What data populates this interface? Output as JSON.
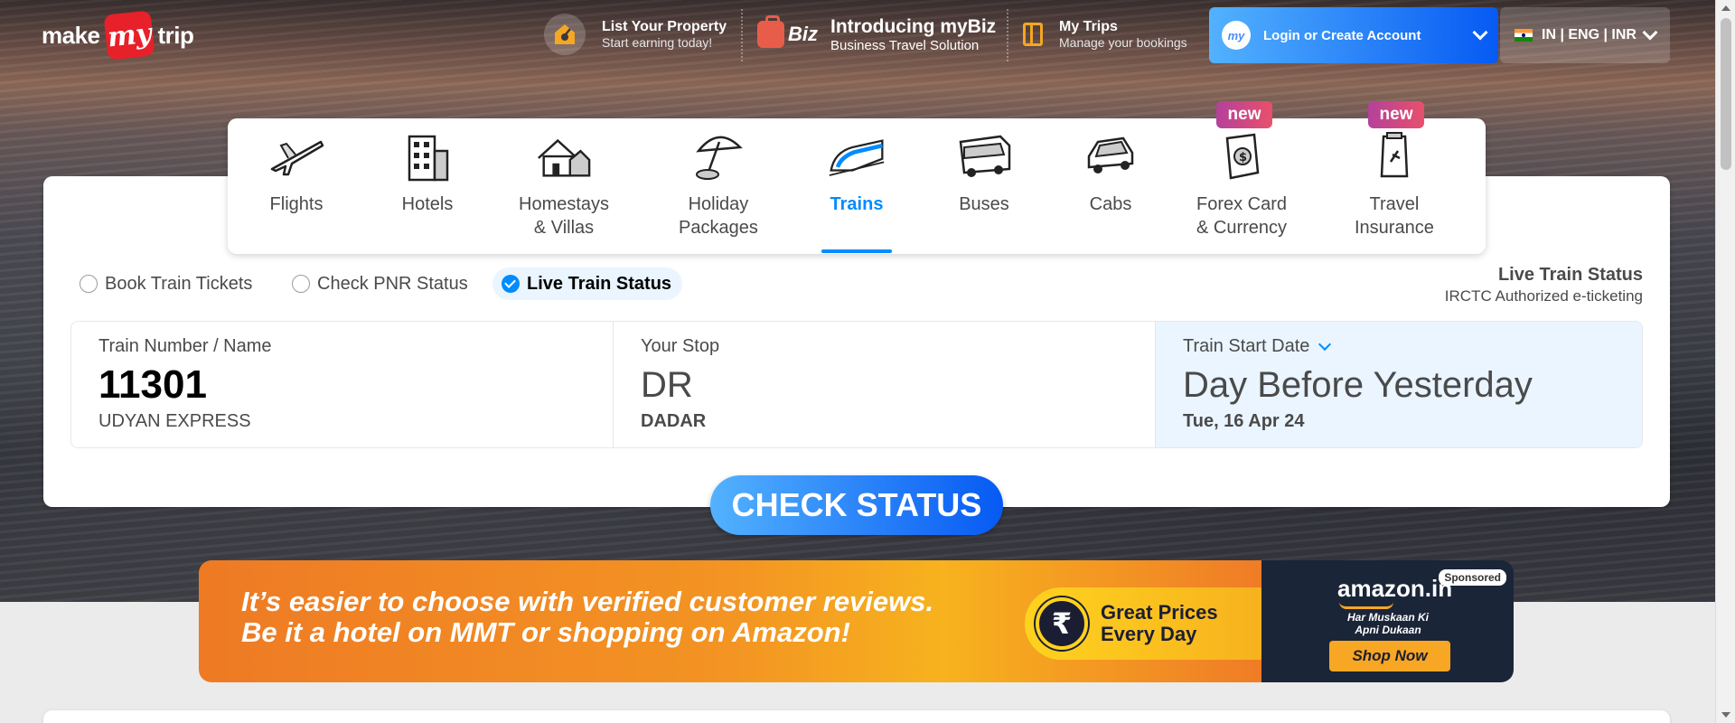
{
  "header": {
    "logo": {
      "left": "make",
      "middle": "my",
      "right": "trip"
    },
    "list_property": {
      "title": "List Your Property",
      "subtitle": "Start earning today!"
    },
    "mybiz": {
      "badge": "Biz",
      "title": "Introducing myBiz",
      "subtitle": "Business Travel Solution"
    },
    "my_trips": {
      "title": "My Trips",
      "subtitle": "Manage your bookings"
    },
    "login": {
      "avatar": "my",
      "label": "Login or Create Account"
    },
    "locale": {
      "label": "IN | ENG | INR"
    }
  },
  "nav": {
    "items": [
      {
        "label": "Flights",
        "icon": "airplane-icon"
      },
      {
        "label": "Hotels",
        "icon": "building-icon"
      },
      {
        "label": "Homestays\n& Villas",
        "icon": "house-icon"
      },
      {
        "label": "Holiday\nPackages",
        "icon": "umbrella-icon"
      },
      {
        "label": "Trains",
        "icon": "train-icon",
        "active": true
      },
      {
        "label": "Buses",
        "icon": "bus-icon"
      },
      {
        "label": "Cabs",
        "icon": "car-icon"
      },
      {
        "label": "Forex Card\n& Currency",
        "icon": "forex-card-icon",
        "badge": "new"
      },
      {
        "label": "Travel\nInsurance",
        "icon": "insurance-icon",
        "badge": "new"
      }
    ],
    "badges": {
      "forex": "new",
      "insurance": "new"
    }
  },
  "modes": {
    "book": "Book Train Tickets",
    "pnr": "Check PNR Status",
    "live": "Live Train Status",
    "selected": "live"
  },
  "side_note": {
    "title": "Live Train Status",
    "subtitle": "IRCTC Authorized e-ticketing"
  },
  "fields": {
    "train": {
      "label": "Train Number / Name",
      "value": "11301",
      "sub": "UDYAN EXPRESS"
    },
    "stop": {
      "label": "Your Stop",
      "value": "DR",
      "sub": "DADAR"
    },
    "date": {
      "label": "Train Start Date",
      "value": "Day Before Yesterday",
      "sub": "Tue, 16 Apr 24"
    }
  },
  "check_button": "CHECK STATUS",
  "ad": {
    "line1": "It’s easier to choose with verified customer reviews.",
    "line2": "Be it a hotel on MMT or shopping on Amazon!",
    "rupee": "₹",
    "pill_line1": "Great Prices",
    "pill_line2": "Every Day",
    "brand": "amazon.in",
    "tagline": "Har Muskaan Ki\nApni Dukaan",
    "sponsored": "Sponsored",
    "shop_now": "Shop Now"
  },
  "colors": {
    "accent": "#008cff",
    "brand_red": "#e8202a",
    "button_start": "#53b2fe",
    "button_end": "#065af3"
  }
}
